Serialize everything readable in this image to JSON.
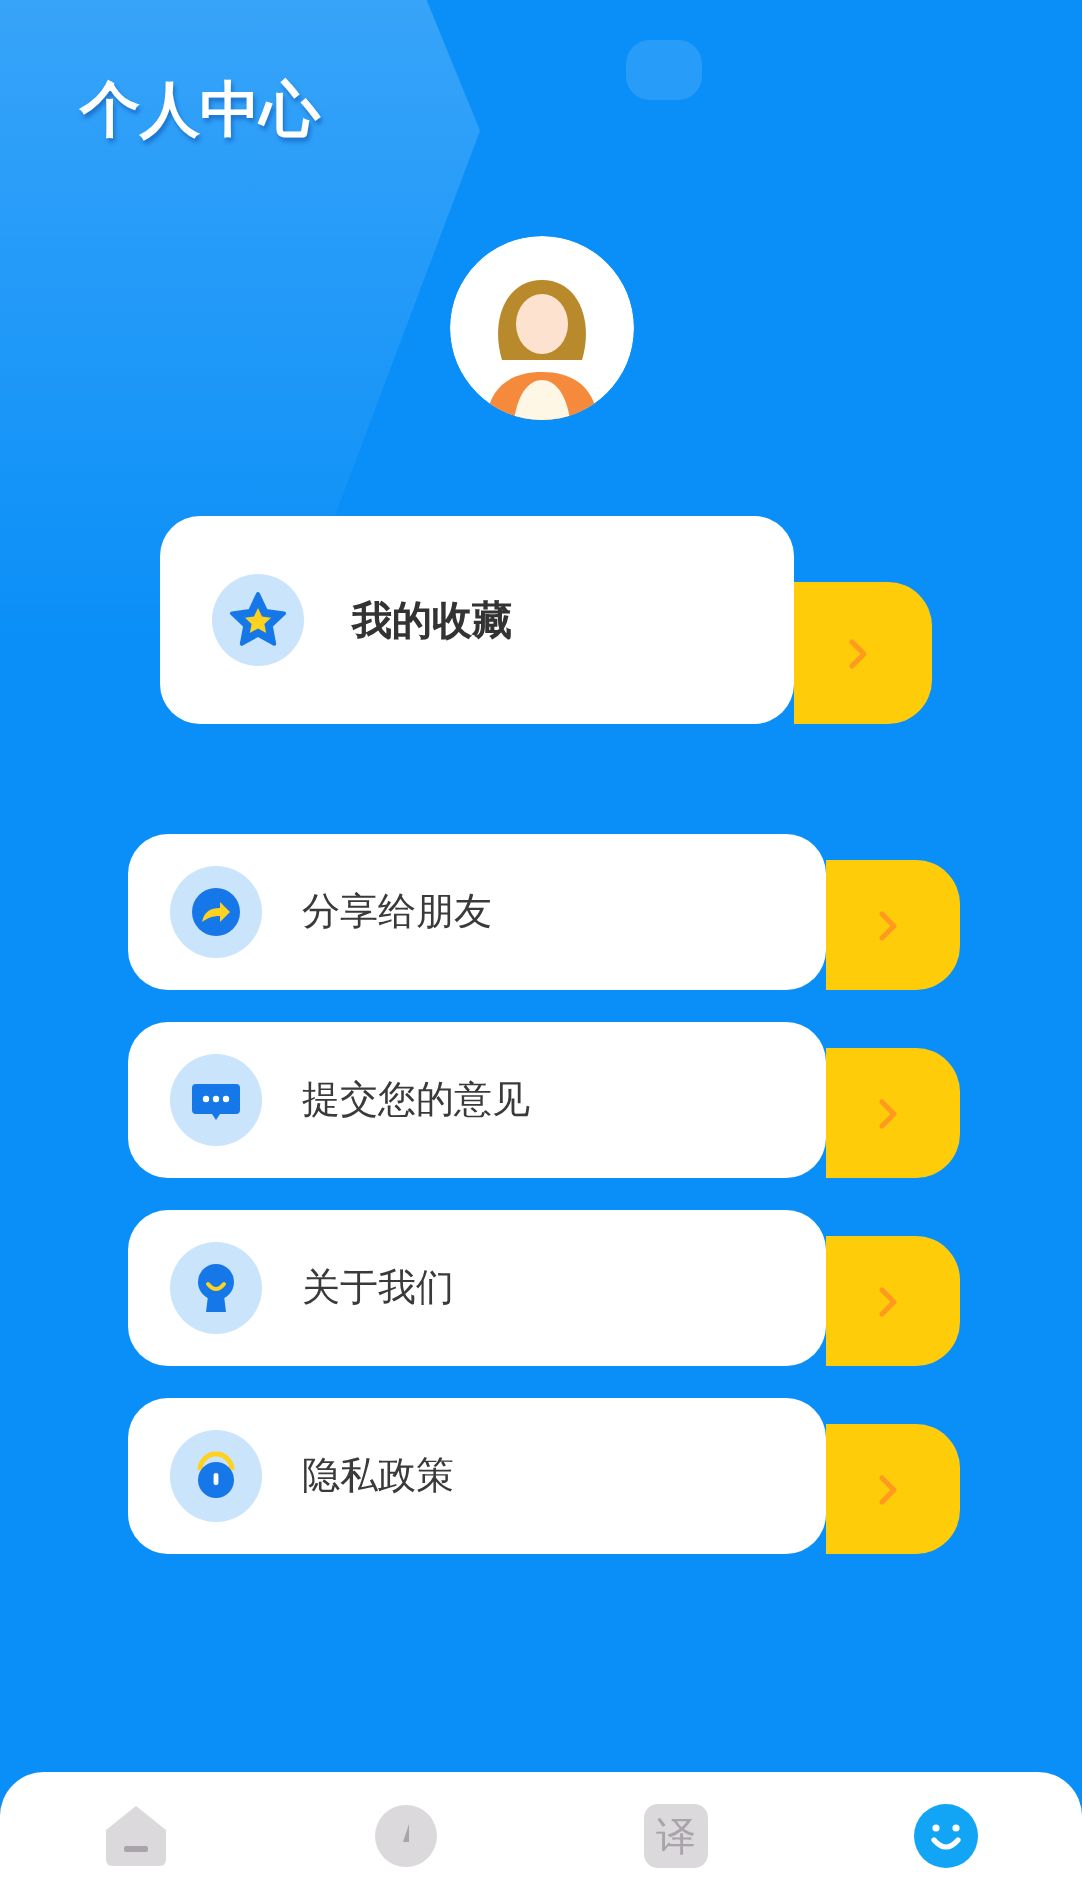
{
  "header": {
    "title": "个人中心"
  },
  "favorites": {
    "label": "我的收藏",
    "kind": "star"
  },
  "menu": [
    {
      "label": "分享给朋友",
      "kind": "share"
    },
    {
      "label": "提交您的意见",
      "kind": "chat"
    },
    {
      "label": "关于我们",
      "kind": "person"
    },
    {
      "label": "隐私政策",
      "kind": "lock"
    }
  ],
  "tabs": [
    {
      "kind": "home",
      "selected": false
    },
    {
      "kind": "compass",
      "selected": false
    },
    {
      "kind": "translate",
      "glyph": "译",
      "selected": false
    },
    {
      "kind": "profile",
      "selected": true
    }
  ]
}
